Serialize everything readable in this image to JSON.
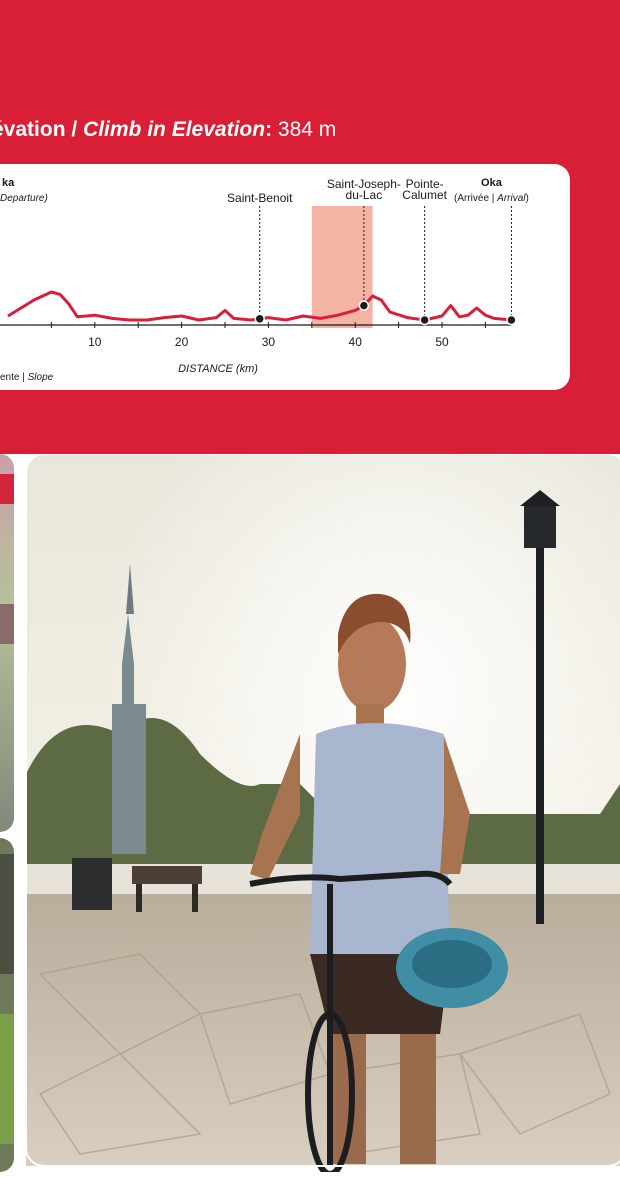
{
  "heading": {
    "part_fr": "évation / ",
    "part_en": "Climb in Elevation",
    "sep": ": ",
    "value": "384 m"
  },
  "chart_data": {
    "type": "line",
    "xlabel": "DISTANCE (km)",
    "xlim": [
      0,
      58
    ],
    "x_ticks": [
      "10",
      "20",
      "30",
      "40",
      "50"
    ],
    "slope_label": {
      "fr": "ente | ",
      "en": "Slope"
    },
    "highlight_range_km": [
      35,
      42
    ],
    "towns": [
      {
        "name_line1": "Saint-Benoit",
        "name_line2": "",
        "km": 29
      },
      {
        "name_line1": "Saint-Joseph-",
        "name_line2": "du-Lac",
        "km": 41
      },
      {
        "name_line1": "Pointe-",
        "name_line2": "Calumet",
        "km": 48
      },
      {
        "name_line1": "Oka",
        "name_line2": "",
        "km": 58
      }
    ],
    "start_label": {
      "name": "ka",
      "sub": "Departure)"
    },
    "end_label": {
      "name": "Oka",
      "sub_a": "(Arrivée | ",
      "sub_b": "Arrival",
      "sub_c": ")"
    },
    "profile": [
      [
        0,
        0.5
      ],
      [
        3,
        2.5
      ],
      [
        5,
        3.5
      ],
      [
        6,
        3.2
      ],
      [
        7,
        2.0
      ],
      [
        8,
        0.4
      ],
      [
        10,
        0.6
      ],
      [
        12,
        0.2
      ],
      [
        14,
        0.0
      ],
      [
        16,
        0.0
      ],
      [
        18,
        0.3
      ],
      [
        20,
        0.5
      ],
      [
        22,
        0.0
      ],
      [
        24,
        0.3
      ],
      [
        25,
        1.2
      ],
      [
        26,
        0.2
      ],
      [
        28,
        0.0
      ],
      [
        30,
        0.3
      ],
      [
        32,
        0.0
      ],
      [
        34,
        0.5
      ],
      [
        36,
        0.2
      ],
      [
        38,
        0.6
      ],
      [
        40,
        1.2
      ],
      [
        41,
        1.8
      ],
      [
        42,
        3.0
      ],
      [
        43,
        2.5
      ],
      [
        44,
        1.0
      ],
      [
        46,
        0.3
      ],
      [
        48,
        0.0
      ],
      [
        50,
        0.5
      ],
      [
        51,
        1.8
      ],
      [
        52,
        0.4
      ],
      [
        53,
        0.6
      ],
      [
        54,
        1.5
      ],
      [
        55,
        0.6
      ],
      [
        56,
        0.2
      ],
      [
        58,
        0.0
      ]
    ]
  },
  "photos": {
    "left_top_alt": "",
    "main_alt": ""
  }
}
